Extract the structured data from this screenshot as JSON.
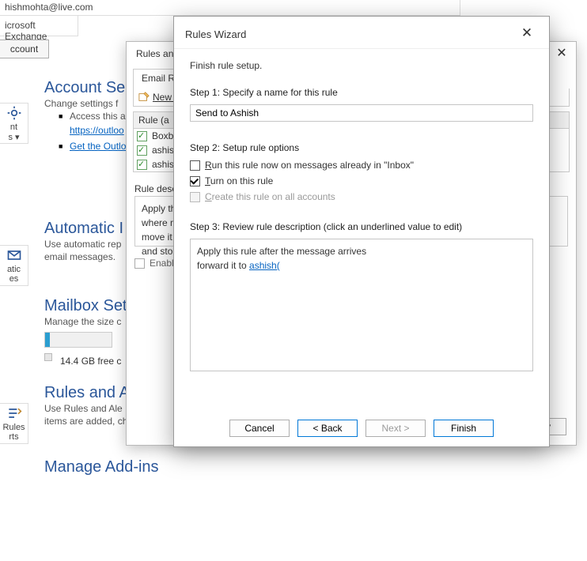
{
  "bg": {
    "email": "hishmohta@live.com",
    "provider": "icrosoft Exchange",
    "account_link": "ccount",
    "sections": {
      "acct_title": "Account Se",
      "acct_sub": "Change settings f",
      "acct_bullet1": "Access this a",
      "acct_link1": "https://outloo",
      "acct_bullet2_prefix": "Get the Outlo",
      "auto_title": "Automatic I",
      "auto_sub": "Use automatic rep",
      "auto_sub2": "email messages.",
      "mailbox_title": "Mailbox Set",
      "mailbox_sub": "Manage the size c",
      "mailbox_free": "14.4 GB free c",
      "rules_title": "Rules and A",
      "rules_sub1": "Use Rules and Ale",
      "rules_sub2": "items are added, changed, or r",
      "addins_title": "Manage Add-ins"
    },
    "left_badges": [
      "nt",
      "s ▾",
      "atic",
      "es",
      "Rules",
      "rts"
    ]
  },
  "rules_dialog": {
    "title": "Rules and A",
    "tabs": [
      "Email Rule"
    ],
    "new_rule": "New R",
    "header": "Rule (a",
    "rows": [
      "Boxbe",
      "ashish",
      "ashish"
    ],
    "desc_label": "Rule descr",
    "desc_lines": [
      "Apply th",
      "where m",
      "move it t",
      "and sto"
    ],
    "enable": "Enable",
    "apply": "Apply"
  },
  "wizard": {
    "title": "Rules Wizard",
    "finish": "Finish rule setup.",
    "step1": "Step 1: Specify a name for this rule",
    "rule_name": "Send to Ashish",
    "step2": "Step 2: Setup rule options",
    "opt_run_prefix": "R",
    "opt_run_rest": "un this rule now on messages already in \"Inbox\"",
    "opt_turn_prefix": "T",
    "opt_turn_rest": "urn on this rule",
    "opt_create_prefix": "C",
    "opt_create_rest": "reate this rule on all accounts",
    "step3": "Step 3: Review rule description (click an underlined value to edit)",
    "review_line1": "Apply this rule after the message arrives",
    "review_line2_prefix": "forward it to ",
    "review_link": "ashish(",
    "buttons": {
      "cancel": "Cancel",
      "back": "<  Back",
      "next": "Next  >",
      "finish": "Finish"
    }
  }
}
